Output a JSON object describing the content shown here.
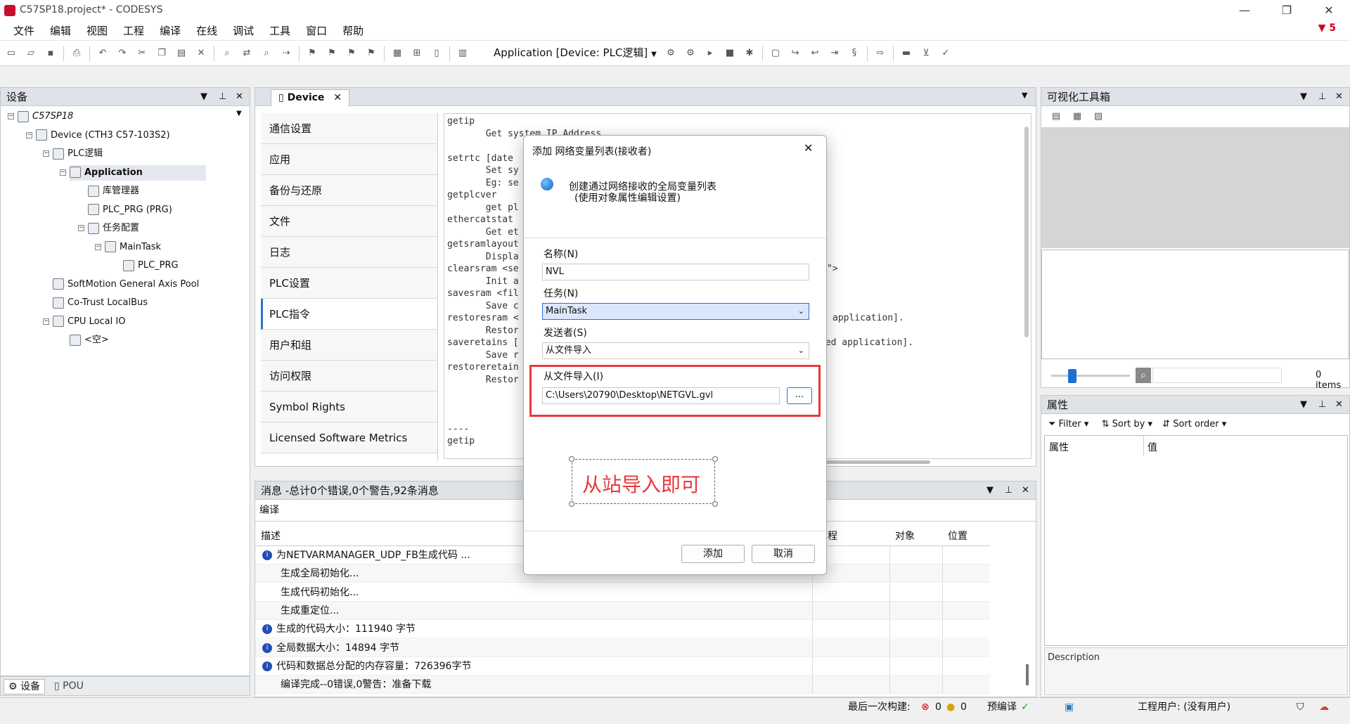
{
  "window": {
    "title": "C57SP18.project* - CODESYS",
    "minimize": "—",
    "restore": "❐",
    "close": "✕"
  },
  "menu": [
    "文件",
    "编辑",
    "视图",
    "工程",
    "编译",
    "在线",
    "调试",
    "工具",
    "窗口",
    "帮助"
  ],
  "alert_badge": "5",
  "toolbar": {
    "app_combo": "Application [Device: PLC逻辑]"
  },
  "devices_panel": {
    "title": "设备",
    "tree": [
      {
        "label": "C57SP18",
        "depth": 0,
        "italic": true
      },
      {
        "label": "Device (CTH3 C57-103S2)",
        "depth": 1
      },
      {
        "label": "PLC逻辑",
        "depth": 2
      },
      {
        "label": "Application",
        "depth": 3,
        "bold": true
      },
      {
        "label": "库管理器",
        "depth": 4
      },
      {
        "label": "PLC_PRG (PRG)",
        "depth": 4
      },
      {
        "label": "任务配置",
        "depth": 4
      },
      {
        "label": "MainTask",
        "depth": 5
      },
      {
        "label": "PLC_PRG",
        "depth": 6
      },
      {
        "label": "SoftMotion General Axis Pool",
        "depth": 2
      },
      {
        "label": "Co-Trust LocalBus",
        "depth": 2
      },
      {
        "label": "CPU Local IO",
        "depth": 2
      },
      {
        "label": "<空>",
        "depth": 3
      }
    ],
    "bottom_tabs": [
      "设备",
      "POU"
    ]
  },
  "editor": {
    "tab": "Device",
    "side_items": [
      "通信设置",
      "应用",
      "备份与还原",
      "文件",
      "日志",
      "PLC设置",
      "PLC指令",
      "用户和组",
      "访问权限",
      "Symbol Rights",
      "Licensed Software Metrics"
    ],
    "active_side": "PLC指令",
    "code": "getip\n       Get system IP Address\n\nsetrtc [date\n       Set sy\n       Eg: se\ngetplcver\n       get pl\nethercatstat\n       Get et\ngetsramlayout\n       Displa\nclearsram <se\n       Init a\nsavesram <fil\n       Save c\nrestoresram <\n       Restor\nsaveretains [\n       Save r\nrestoreretain\n       Restor\n\n\n\n----\ngetip",
    "code_right": [
      "\">",
      "application].",
      "ied application]."
    ]
  },
  "messages": {
    "title": "消息 -总计0个错误,0个警告,92条消息",
    "subtitle": "编译",
    "columns": [
      "描述",
      "工程",
      "对象",
      "位置"
    ],
    "rows": [
      {
        "icon": true,
        "text": "为NETVARMANAGER_UDP_FB生成代码 ..."
      },
      {
        "icon": false,
        "text": "生成全局初始化..."
      },
      {
        "icon": false,
        "text": "生成代码初始化..."
      },
      {
        "icon": false,
        "text": "生成重定位..."
      },
      {
        "icon": true,
        "text": "生成的代码大小：111940 字节"
      },
      {
        "icon": true,
        "text": "全局数据大小：14894 字节"
      },
      {
        "icon": true,
        "text": "代码和数据总分配的内存容量：726396字节"
      },
      {
        "icon": false,
        "text": "编译完成--0错误,0警告：准备下载"
      }
    ]
  },
  "toolbox": {
    "title": "可视化工具箱",
    "items_count": "0 items"
  },
  "properties": {
    "title": "属性",
    "filter": "Filter",
    "sort_by": "Sort by",
    "sort_order": "Sort order",
    "col_prop": "属性",
    "col_value": "值",
    "description": "Description"
  },
  "status": {
    "last_build": "最后一次构建:",
    "errors": "0",
    "warnings": "0",
    "precompile": "预编译",
    "user": "工程用户: (没有用户)"
  },
  "dialog": {
    "title": "添加 网络变量列表(接收者)",
    "close": "✕",
    "desc_line1": "创建通过网络接收的全局变量列表",
    "desc_line2": "(使用对象属性编辑设置)",
    "name_label": "名称(N)",
    "name_value": "NVL",
    "task_label": "任务(N)",
    "task_value": "MainTask",
    "sender_label": "发送者(S)",
    "sender_value": "从文件导入",
    "import_label": "从文件导入(I)",
    "import_value": "C:\\Users\\20790\\Desktop\\NETGVL.gvl",
    "browse": "...",
    "annotation": "从站导入即可",
    "add": "添加",
    "cancel": "取消"
  }
}
